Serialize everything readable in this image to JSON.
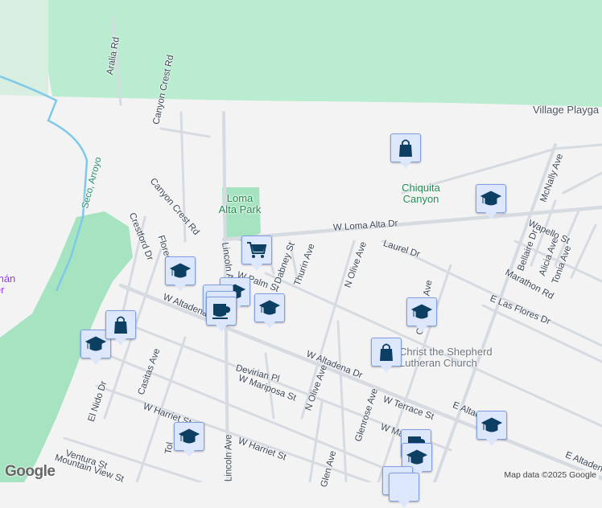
{
  "colors": {
    "background": "#f4f3f4",
    "forest": "#b9ecd0",
    "park": "#a6e3c0",
    "road": "#d5dbe1",
    "marker": "#0d3f63",
    "marker_bg": "#dde7fb"
  },
  "labels": [
    "Aralia Rd",
    "Canyon Crest Rd",
    "Canyon Crest Rd",
    "Village Playga",
    "Chiquita Canyon",
    "Loma Alta Park",
    "Seco, Arroyo",
    "W Loma Alta Dr",
    "Laurel Dr",
    "Dabney St",
    "Thurin Ave",
    "N Olive Ave",
    "W Palm St",
    "Lincoln Ave",
    "W Altadena Dr",
    "W Altadena Dr",
    "Crestford Dr",
    "Florecita Dr",
    "Casitas Ave",
    "Devirian Pl",
    "W Mariposa St",
    "W Harriet St",
    "W Harriet St",
    "El Nido Dr",
    "Ventura St",
    "Mountain View St",
    "Tol",
    "N Olive Ave",
    "Glenrose Ave",
    "Glenrose Ave",
    "W Terrace St",
    "W Ma",
    "Glen Ave",
    "E Altadena Dr",
    "E Altadena Dr",
    "E Las Flores Dr",
    "Marathon Rd",
    "Bellaire Dr",
    "Alicia Ave",
    "Tonia Ave",
    "Wapello St",
    "McNally Ave",
    "Christ the Shepherd Lutheran Church",
    "mán er",
    "Lincoln Ave"
  ],
  "markers": [
    {
      "type": "school",
      "icon": "graduation-cap-icon"
    },
    {
      "type": "shopping",
      "icon": "shopping-bag-icon"
    },
    {
      "type": "grocery",
      "icon": "shopping-cart-icon"
    },
    {
      "type": "cafe",
      "icon": "coffee-cup-icon"
    }
  ],
  "attribution": "Map data ©2025 Google",
  "logo": "Google"
}
